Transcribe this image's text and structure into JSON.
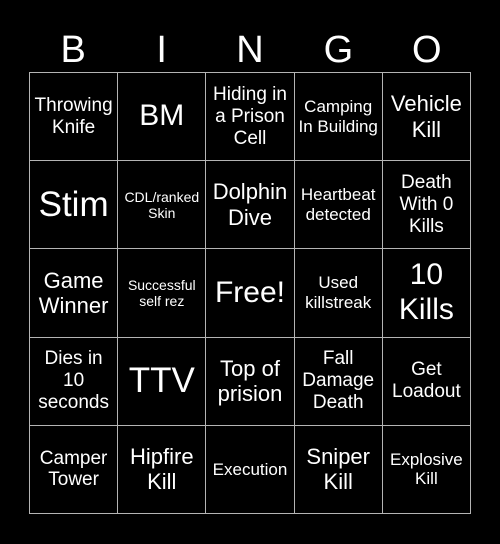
{
  "header": {
    "letters": [
      "B",
      "I",
      "N",
      "G",
      "O"
    ]
  },
  "colors": {
    "background": "#000000",
    "text": "#ffffff",
    "grid": "#b4b4b4"
  },
  "board": {
    "cells": [
      {
        "text": "Throwing Knife",
        "size": "m"
      },
      {
        "text": "BM",
        "size": "xl"
      },
      {
        "text": "Hiding in a Prison Cell",
        "size": "m"
      },
      {
        "text": "Camping In Building",
        "size": "s"
      },
      {
        "text": "Vehicle Kill",
        "size": "l"
      },
      {
        "text": "Stim",
        "size": "xxl"
      },
      {
        "text": "CDL/ranked Skin",
        "size": "xs"
      },
      {
        "text": "Dolphin Dive",
        "size": "l"
      },
      {
        "text": "Heartbeat detected",
        "size": "s"
      },
      {
        "text": "Death With 0 Kills",
        "size": "m"
      },
      {
        "text": "Game Winner",
        "size": "l"
      },
      {
        "text": "Successful self rez",
        "size": "xs"
      },
      {
        "text": "Free!",
        "size": "xl"
      },
      {
        "text": "Used killstreak",
        "size": "s"
      },
      {
        "text": "10 Kills",
        "size": "xl"
      },
      {
        "text": "Dies in 10 seconds",
        "size": "m"
      },
      {
        "text": "TTV",
        "size": "xxl"
      },
      {
        "text": "Top of prision",
        "size": "l"
      },
      {
        "text": "Fall Damage Death",
        "size": "m"
      },
      {
        "text": "Get Loadout",
        "size": "m"
      },
      {
        "text": "Camper Tower",
        "size": "m"
      },
      {
        "text": "Hipfire Kill",
        "size": "l"
      },
      {
        "text": "Execution",
        "size": "s"
      },
      {
        "text": "Sniper Kill",
        "size": "l"
      },
      {
        "text": "Explosive Kill",
        "size": "s"
      }
    ]
  }
}
